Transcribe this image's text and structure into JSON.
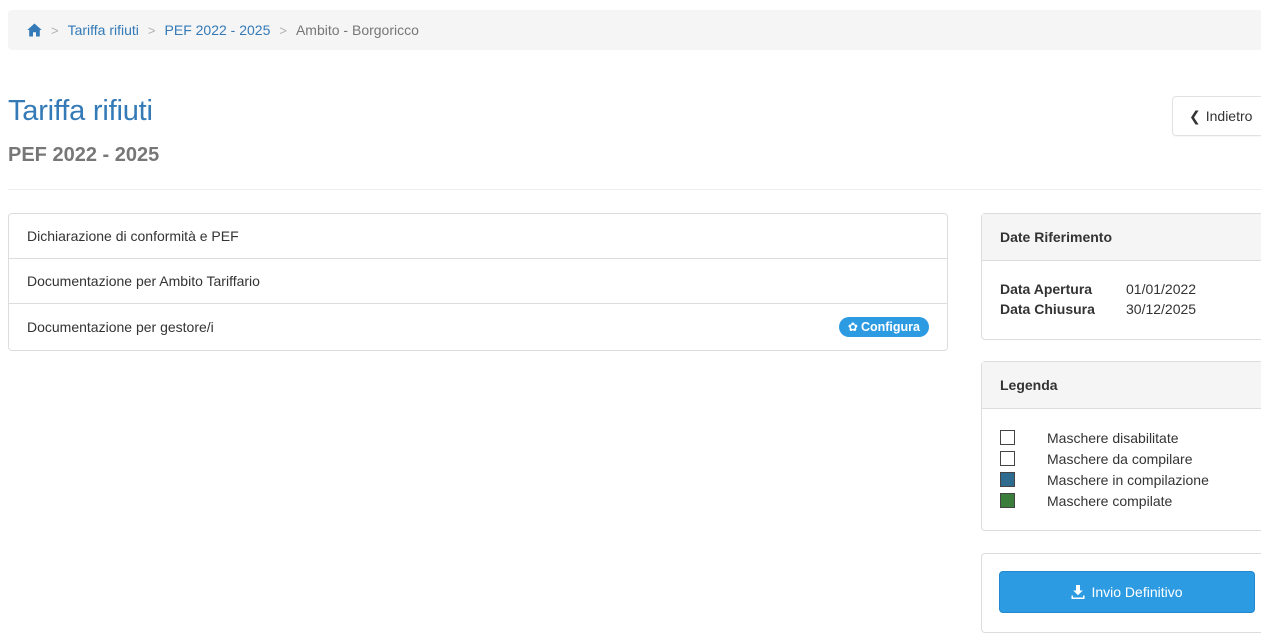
{
  "breadcrumb": {
    "home_icon": "home-icon",
    "items": [
      "Tariffa rifiuti",
      "PEF 2022 - 2025"
    ],
    "separator": ">",
    "current": "Ambito - Borgoricco"
  },
  "header": {
    "title": "Tariffa rifiuti",
    "subtitle": "PEF 2022 - 2025",
    "back_label": "Indietro",
    "back_icon": "chevron-left-icon"
  },
  "documents": {
    "items": [
      {
        "label": "Dichiarazione di conformità e PEF"
      },
      {
        "label": "Documentazione per Ambito Tariffario"
      },
      {
        "label": "Documentazione per gestore/i",
        "badge": "Configura",
        "badge_icon": "gear-icon"
      }
    ]
  },
  "dates_panel": {
    "title": "Date Riferimento",
    "rows": [
      {
        "label": "Data Apertura",
        "value": "01/01/2022"
      },
      {
        "label": "Data Chiusura",
        "value": "30/12/2025"
      }
    ]
  },
  "legend_panel": {
    "title": "Legenda",
    "items": [
      {
        "label": "Maschere disabilitate",
        "color": "#ffffff"
      },
      {
        "label": "Maschere da compilare",
        "color": "#ffffff"
      },
      {
        "label": "Maschere in compilazione",
        "color": "#2f6a8f"
      },
      {
        "label": "Maschere compilate",
        "color": "#3b7d3b"
      }
    ]
  },
  "submit": {
    "label": "Invio Definitivo",
    "icon": "download-icon"
  },
  "colors": {
    "link": "#337ab7",
    "primary_button": "#2d9be2"
  }
}
